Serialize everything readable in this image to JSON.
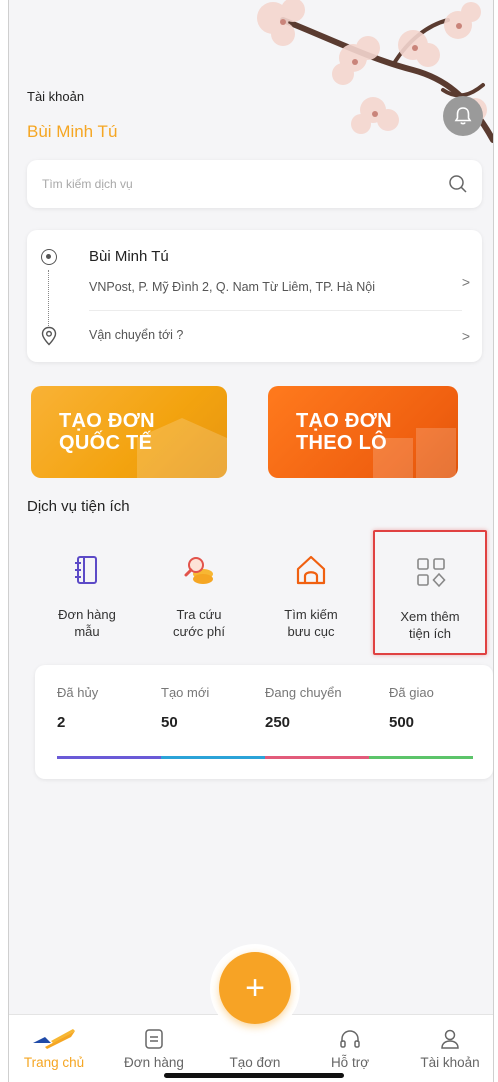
{
  "header": {
    "account_label": "Tài khoản",
    "account_name": "Bùi Minh Tú"
  },
  "search": {
    "placeholder": "Tìm kiếm dịch vụ"
  },
  "address": {
    "sender_name": "Bùi Minh Tú",
    "sender_address": "VNPost, P. Mỹ Đình 2, Q. Nam Từ Liêm, TP. Hà Nội",
    "destination_placeholder": "Vận chuyển tới ?",
    "chevron": ">"
  },
  "actions": {
    "international": {
      "line1": "TẠO ĐƠN",
      "line2": "QUỐC TẾ"
    },
    "batch": {
      "line1": "TẠO ĐƠN",
      "line2": "THEO LÔ"
    }
  },
  "services": {
    "title": "Dịch vụ tiện ích",
    "items": [
      {
        "label": "Đơn hàng\nmẫu",
        "icon": "order-template-icon"
      },
      {
        "label": "Tra cứu\ncước phí",
        "icon": "fee-lookup-icon"
      },
      {
        "label": "Tìm kiếm\nbưu cục",
        "icon": "post-office-icon"
      },
      {
        "label": "Xem thêm\ntiện ích",
        "icon": "grid-more-icon"
      }
    ]
  },
  "stats": {
    "items": [
      {
        "label": "Đã hủy",
        "value": "2",
        "color": "#6a5ad7"
      },
      {
        "label": "Tạo mới",
        "value": "50",
        "color": "#2ba3d8"
      },
      {
        "label": "Đang chuyển",
        "value": "250",
        "color": "#e25b7a"
      },
      {
        "label": "Đã giao",
        "value": "500",
        "color": "#5cc46a"
      }
    ]
  },
  "tabbar": {
    "items": [
      {
        "label": "Trang chủ",
        "active": true
      },
      {
        "label": "Đơn hàng"
      },
      {
        "label": "Tạo đơn"
      },
      {
        "label": "Hỗ trợ"
      },
      {
        "label": "Tài khoản"
      }
    ],
    "fab_symbol": "+"
  },
  "colors": {
    "brand": "#f5a623",
    "highlight": "#e04141"
  }
}
